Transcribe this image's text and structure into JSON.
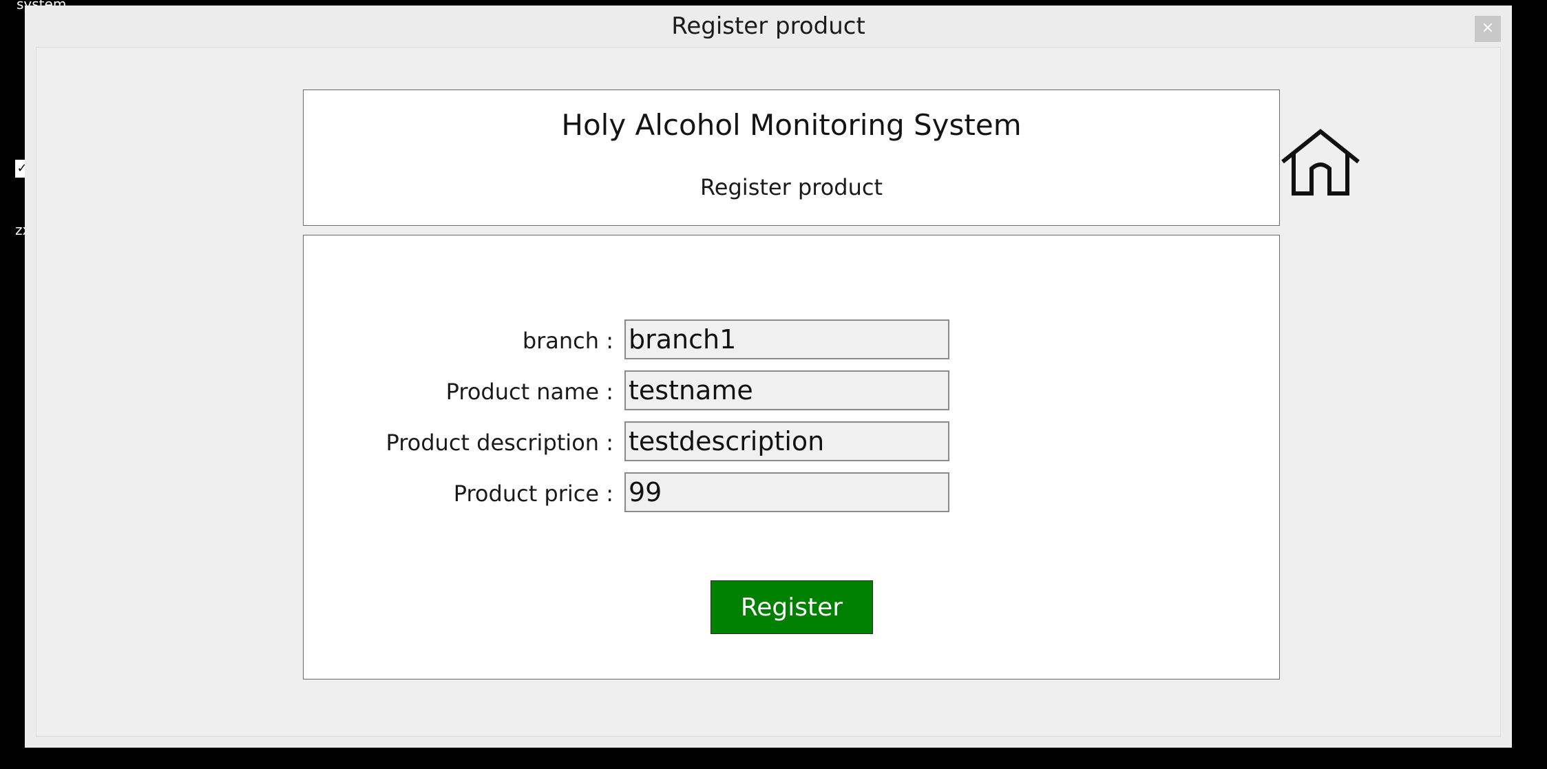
{
  "background": {
    "label_top": "system",
    "label_side": "zx"
  },
  "window": {
    "title": "Register product",
    "close_label": "×"
  },
  "header": {
    "app_title": "Holy Alcohol Monitoring System",
    "subtitle": "Register product"
  },
  "home_icon": "home-icon",
  "form": {
    "fields": [
      {
        "label": "branch :",
        "value": "branch1"
      },
      {
        "label": "Product name :",
        "value": "testname"
      },
      {
        "label": "Product description :",
        "value": "testdescription"
      },
      {
        "label": "Product price :",
        "value": "99"
      }
    ],
    "submit_label": "Register"
  },
  "colors": {
    "accent_button": "#008000",
    "window_bg": "#ececec",
    "input_bg": "#f0f0f0"
  }
}
